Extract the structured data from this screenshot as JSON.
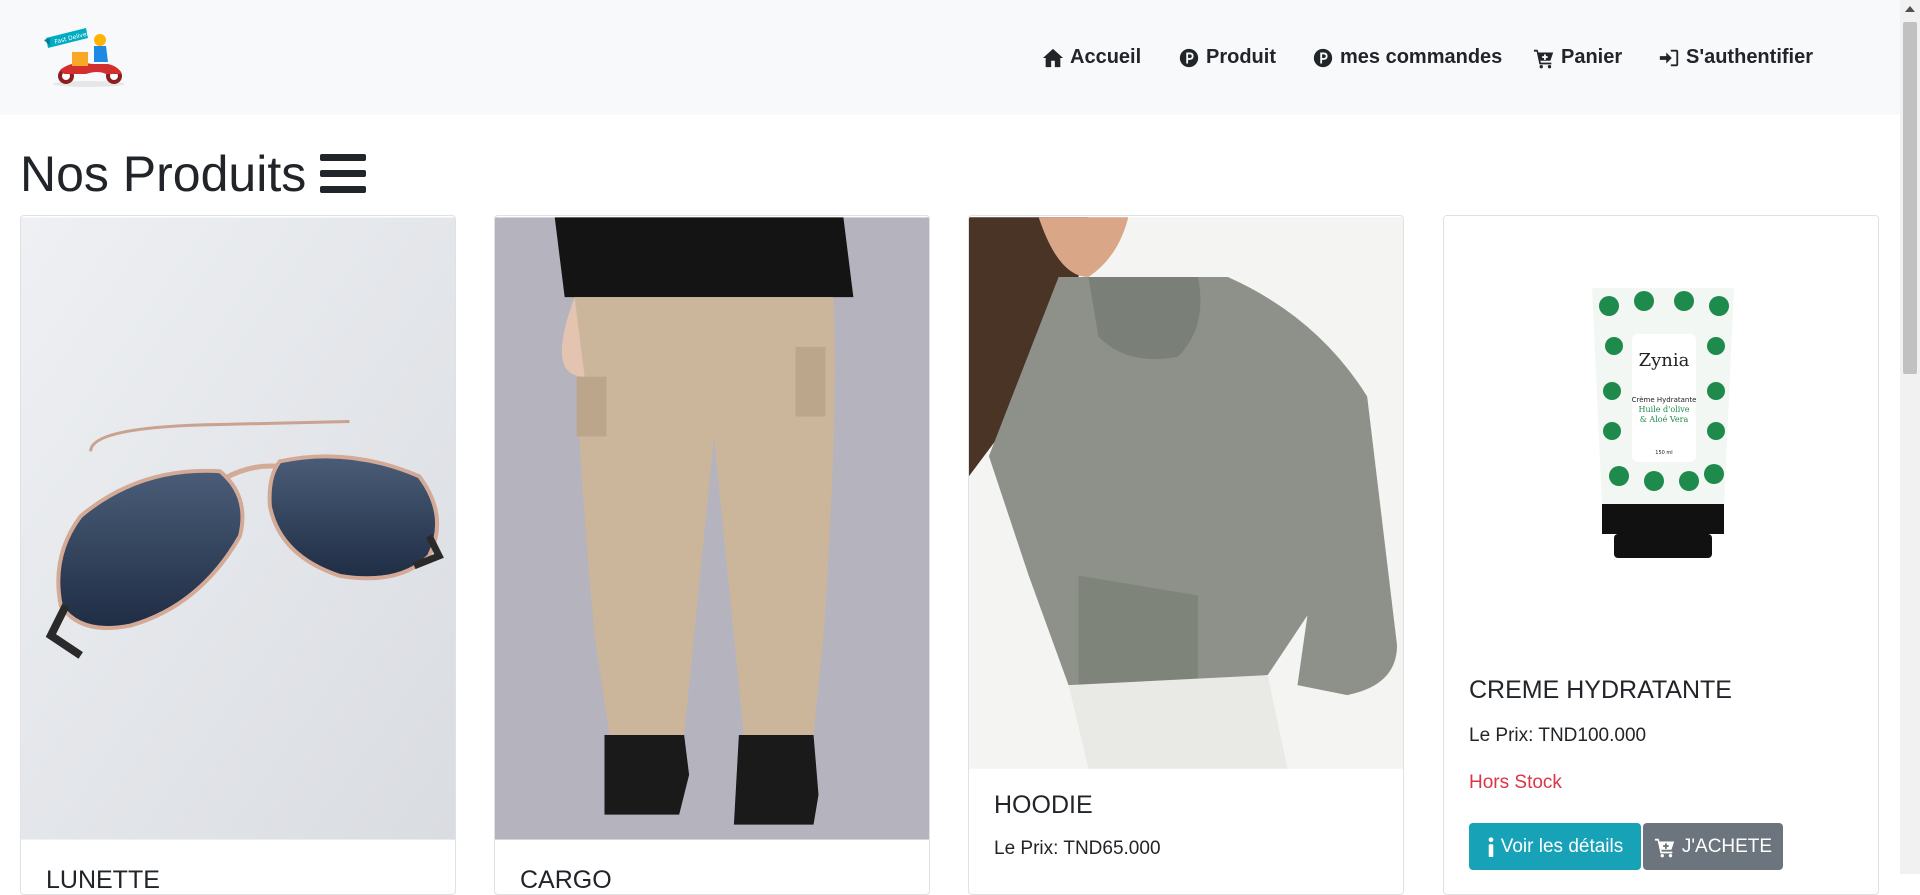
{
  "navbar": {
    "logo_alt": "Fast Delivery",
    "items": [
      {
        "label": "Accueil",
        "icon": "home-icon"
      },
      {
        "label": "Produit",
        "icon": "p-circle-icon"
      },
      {
        "label": "mes commandes",
        "icon": "p-circle-icon"
      },
      {
        "label": "Panier",
        "icon": "cart-icon"
      },
      {
        "label": "S'authentifier",
        "icon": "login-icon"
      }
    ]
  },
  "page": {
    "title": "Nos Produits",
    "title_icon": "bars-icon"
  },
  "products": [
    {
      "name": "LUNETTE",
      "image": "sunglasses on light grey background"
    },
    {
      "name": "CARGO",
      "image": "beige cargo pants with black boots"
    },
    {
      "name": "HOODIE",
      "price_label": "Le Prix: TND65.000",
      "image": "grey hoodie"
    },
    {
      "name": "CREME HYDRATANTE",
      "price_label": "Le Prix: TND100.000",
      "stock": "Hors Stock",
      "details_label": "Voir les détails",
      "buy_label": "J'ACHETE",
      "image": "Zynia cream tube"
    }
  ],
  "product_label": {
    "brand": "Zynia",
    "line1": "Crème Hydratante",
    "line2": "Huile d'olive",
    "line3": "& Aloé Vera",
    "volume": "150 ml"
  },
  "colors": {
    "navbar_bg": "#f8f9fa",
    "info": "#17a2b8",
    "secondary": "#6c757d",
    "danger": "#dc3545"
  }
}
